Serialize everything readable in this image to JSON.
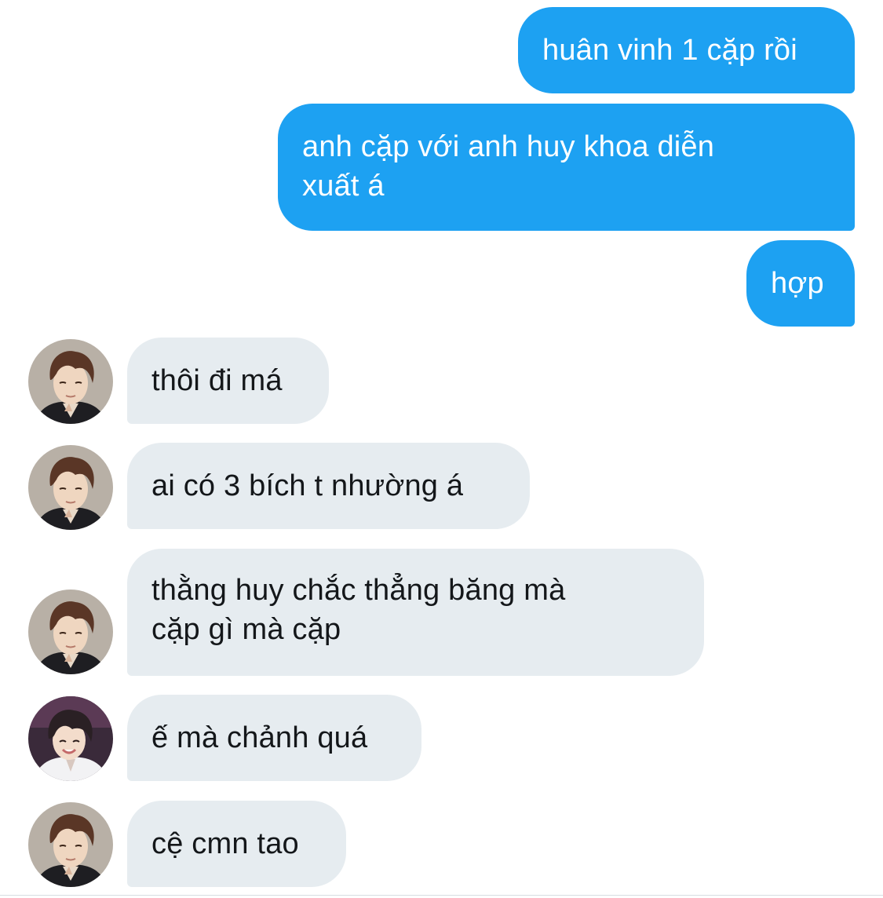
{
  "conversation": {
    "messages": [
      {
        "direction": "sent",
        "lines": [
          "huân vinh 1 cặp rồi"
        ]
      },
      {
        "direction": "sent",
        "lines": [
          "anh cặp với anh huy khoa diễn",
          "xuất á"
        ]
      },
      {
        "direction": "sent",
        "lines": [
          "hợp"
        ]
      },
      {
        "direction": "received",
        "avatar": "avatar-photo-a",
        "lines": [
          "thôi đi má"
        ]
      },
      {
        "direction": "received",
        "avatar": "avatar-photo-a",
        "lines": [
          "ai có 3 bích t nhường á"
        ]
      },
      {
        "direction": "received",
        "avatar": "avatar-photo-a",
        "lines": [
          "thằng huy chắc thẳng băng mà",
          "cặp gì mà cặp"
        ]
      },
      {
        "direction": "received",
        "avatar": "avatar-photo-b",
        "lines": [
          "ế mà chảnh quá"
        ]
      },
      {
        "direction": "received",
        "avatar": "avatar-photo-a",
        "lines": [
          "cệ cmn tao"
        ]
      }
    ]
  },
  "colors": {
    "sent_bubble": "#1DA1F2",
    "received_bubble": "#E6ECF0",
    "sent_text": "#FFFFFF",
    "received_text": "#14171A"
  }
}
